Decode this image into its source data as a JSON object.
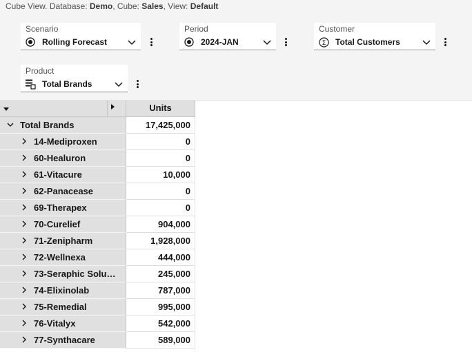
{
  "breadcrumb": {
    "prefix": "Cube View. Database: ",
    "database": "Demo",
    "cube_label": ", Cube: ",
    "cube": "Sales",
    "view_label": ", View: ",
    "view": "Default"
  },
  "selectors": [
    {
      "label": "Scenario",
      "value": "Rolling Forecast",
      "icon": "radio-icon"
    },
    {
      "label": "Period",
      "value": "2024-JAN",
      "icon": "radio-icon"
    },
    {
      "label": "Customer",
      "value": "Total Customers",
      "icon": "sigma-icon"
    },
    {
      "label": "Product",
      "value": "Total Brands",
      "icon": "hierarchy-icon"
    }
  ],
  "grid": {
    "column_header": "Units",
    "rows": [
      {
        "name": "Total Brands",
        "value": "17,425,000",
        "expanded": true
      },
      {
        "name": "14-Mediproxen",
        "value": "0"
      },
      {
        "name": "60-Healuron",
        "value": "0"
      },
      {
        "name": "61-Vitacure",
        "value": "10,000"
      },
      {
        "name": "62-Panacease",
        "value": "0"
      },
      {
        "name": "69-Therapex",
        "value": "0"
      },
      {
        "name": "70-Curelief",
        "value": "904,000"
      },
      {
        "name": "71-Zenipharm",
        "value": "1,928,000"
      },
      {
        "name": "72-Wellnexa",
        "value": "444,000"
      },
      {
        "name": "73-Seraphic Solu…",
        "value": "245,000"
      },
      {
        "name": "74-Elixinolab",
        "value": "787,000"
      },
      {
        "name": "75-Remedial",
        "value": "995,000"
      },
      {
        "name": "76-Vitalyx",
        "value": "542,000"
      },
      {
        "name": "77-Synthacare",
        "value": "589,000"
      }
    ]
  }
}
